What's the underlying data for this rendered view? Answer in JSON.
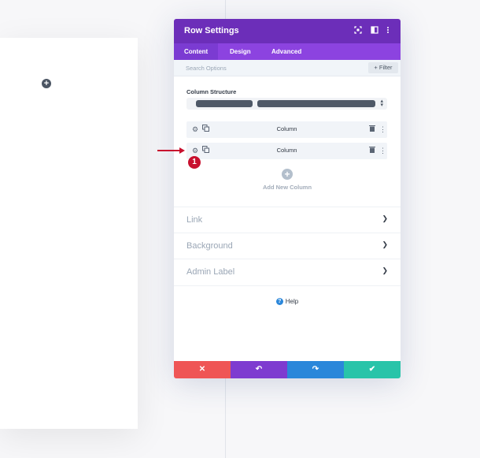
{
  "canvas": {
    "add_icon": "plus-icon"
  },
  "modal": {
    "title": "Row Settings",
    "header_icons": [
      "expand-icon",
      "sidebar-icon",
      "more-icon"
    ],
    "tabs": [
      {
        "label": "Content",
        "active": true
      },
      {
        "label": "Design",
        "active": false
      },
      {
        "label": "Advanced",
        "active": false
      }
    ],
    "search": {
      "placeholder": "Search Options",
      "filter_label": "+ Filter"
    },
    "column_structure_label": "Column Structure",
    "columns": [
      {
        "label": "Column"
      },
      {
        "label": "Column"
      }
    ],
    "add_column_label": "Add New Column",
    "toggles": [
      {
        "label": "Link"
      },
      {
        "label": "Background"
      },
      {
        "label": "Admin Label"
      }
    ],
    "help_label": "Help",
    "footer": {
      "cancel_color": "#ef5555",
      "undo_color": "#7e3bd0",
      "redo_color": "#2b87da",
      "save_color": "#29c4a9"
    }
  },
  "annotation": {
    "badge_number": "1",
    "color": "#c8102e"
  }
}
